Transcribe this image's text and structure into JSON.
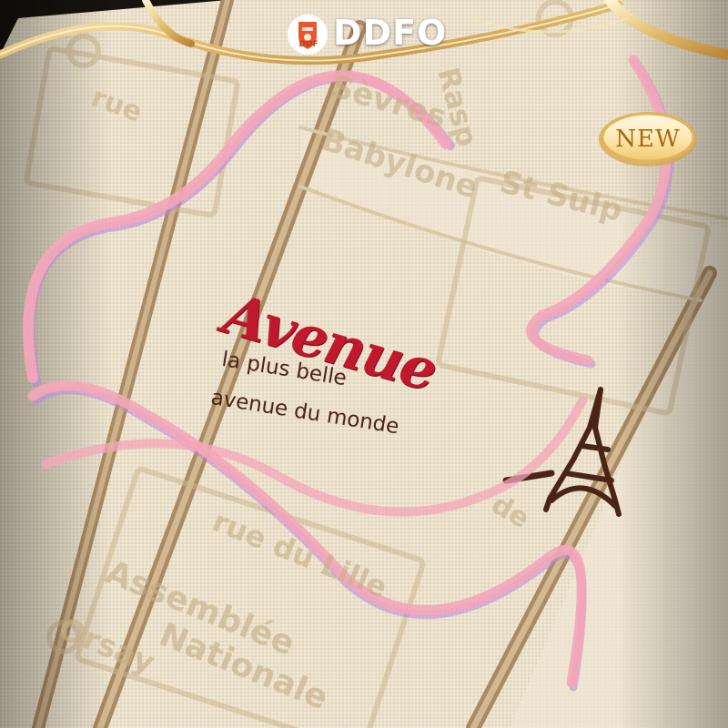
{
  "brand": {
    "logo_emblem_text": "DDF",
    "name": "DDFO",
    "icon": "shield-crest-icon"
  },
  "badge": {
    "label": "NEW"
  },
  "embroidery": {
    "script_title": "Avenue",
    "tagline_line1": "la plus belle",
    "tagline_line2": "avenue du monde",
    "icon": "eiffel-tower-icon"
  },
  "fabric_print": {
    "words": [
      "rue",
      "Sèvres",
      "Babylone",
      "Rasp",
      "St Sulp",
      "rue du Lille",
      "Assemblée",
      "Orsay",
      "Nationale",
      "de"
    ]
  },
  "colors": {
    "canvas": "#eadfca",
    "piping": "#b79b76",
    "embroidery_red": "#c0182c",
    "embroidery_brown": "#4a2416",
    "ribbon": "#f4a6b8",
    "ribbon_shadow": "#b886e0",
    "gold": "#d9b061"
  }
}
